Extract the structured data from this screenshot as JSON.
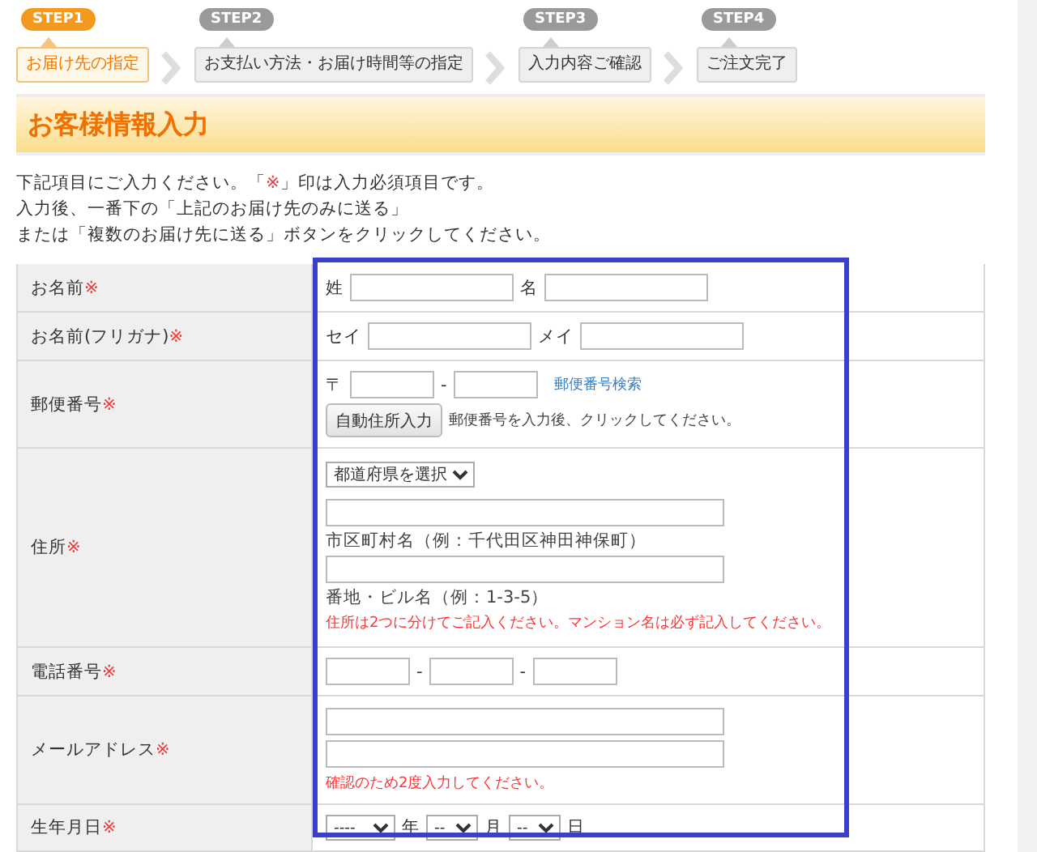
{
  "steps": [
    {
      "badge": "STEP1",
      "label": "お届け先の指定",
      "selected": true
    },
    {
      "badge": "STEP2",
      "label": "お支払い方法・お届け時間等の指定",
      "selected": false
    },
    {
      "badge": "STEP3",
      "label": "入力内容ご確認",
      "selected": false
    },
    {
      "badge": "STEP4",
      "label": "ご注文完了",
      "selected": false
    }
  ],
  "heading": "お客様情報入力",
  "intro": {
    "line1_before": "下記項目にご入力ください。「",
    "line1_mark": "※",
    "line1_after": "」印は入力必須項目です。",
    "line2": "入力後、一番下の「上記のお届け先のみに送る」",
    "line3": "または「複数のお届け先に送る」ボタンをクリックしてください。"
  },
  "required_mark": "※",
  "rows": [
    {
      "kind": "name_pair",
      "label": "お名前",
      "required": true,
      "prefix1": "姓",
      "prefix2": "名"
    },
    {
      "kind": "name_pair",
      "label": "お名前(フリガナ)",
      "required": true,
      "prefix1": "セイ",
      "prefix2": "メイ"
    },
    {
      "kind": "postal",
      "label": "郵便番号",
      "required": true,
      "prefix": "〒",
      "separator": "-",
      "search_link": "郵便番号検索",
      "button": "自動住所入力",
      "hint": "郵便番号を入力後、クリックしてください。"
    },
    {
      "kind": "address",
      "label": "住所",
      "required": true,
      "prefecture": "都道府県を選択",
      "city_caption": "市区町村名（例：千代田区神田神保町）",
      "street_caption": "番地・ビル名（例：1-3-5）",
      "note": "住所は2つに分けてご記入ください。マンション名は必ず記入してください。"
    },
    {
      "kind": "phone",
      "label": "電話番号",
      "required": true,
      "separators": [
        "-",
        "-"
      ]
    },
    {
      "kind": "email",
      "label": "メールアドレス",
      "required": true,
      "note": "確認のため2度入力してください。"
    },
    {
      "kind": "birthdate",
      "label": "生年月日",
      "required": true,
      "selects": [
        {
          "value": "----",
          "unit": "年"
        },
        {
          "value": "--",
          "unit": "月"
        },
        {
          "value": "--",
          "unit": "日"
        }
      ]
    }
  ]
}
